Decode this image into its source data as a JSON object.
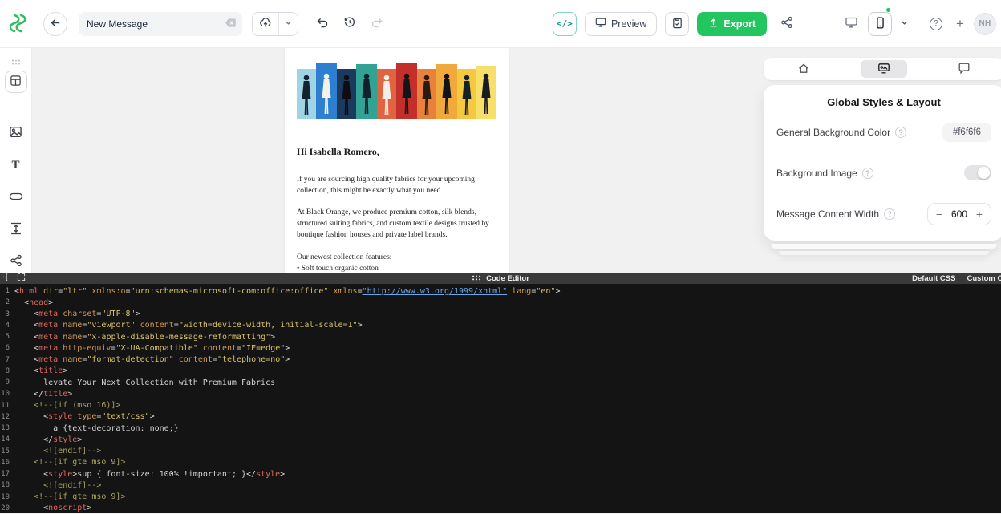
{
  "toolbar": {
    "message_title": "New Message",
    "preview_label": "Preview",
    "export_label": "Export",
    "avatar_initials": "NH"
  },
  "email": {
    "greeting": "Hi  Isabella Romero,",
    "paragraphs": [
      "If you are sourcing high quality fabrics for your upcoming collection, this might be exactly what you need.",
      "At Black Orange, we produce premium cotton, silk blends, structured suiting fabrics, and custom textile designs trusted by boutique fashion houses and private label brands.",
      "Our newest collection features:",
      "• Soft touch organic cotton"
    ]
  },
  "panel": {
    "title": "Global Styles & Layout",
    "general_bg_label": "General Background Color",
    "general_bg_value": "#f6f6f6",
    "bg_image_label": "Background Image",
    "content_width_label": "Message Content Width",
    "content_width_value": "600"
  },
  "code_editor": {
    "title": "Code Editor",
    "default_css_label": "Default CSS",
    "custom_css_label": "Custom CSS",
    "lines": [
      "<html dir=\"ltr\" xmlns:o=\"urn:schemas-microsoft-com:office:office\" xmlns=\"http://www.w3.org/1999/xhtml\" lang=\"en\">",
      "  <head>",
      "    <meta charset=\"UTF-8\">",
      "    <meta name=\"viewport\" content=\"width=device-width, initial-scale=1\">",
      "    <meta name=\"x-apple-disable-message-reformatting\">",
      "    <meta http-equiv=\"X-UA-Compatible\" content=\"IE=edge\">",
      "    <meta name=\"format-detection\" content=\"telephone=no\">",
      "    <title>",
      "      levate Your Next Collection with Premium Fabrics",
      "    </title>",
      "    <!--[if (mso 16)]>",
      "      <style type=\"text/css\">",
      "        a {text-decoration: none;}",
      "      </style>",
      "      <![endif]-->",
      "    <!--[if gte mso 9]>",
      "      <style>sup { font-size: 100% !important; }</style>",
      "      <![endif]-->",
      "    <!--[if gte mso 9]>",
      "      <noscript>"
    ]
  }
}
